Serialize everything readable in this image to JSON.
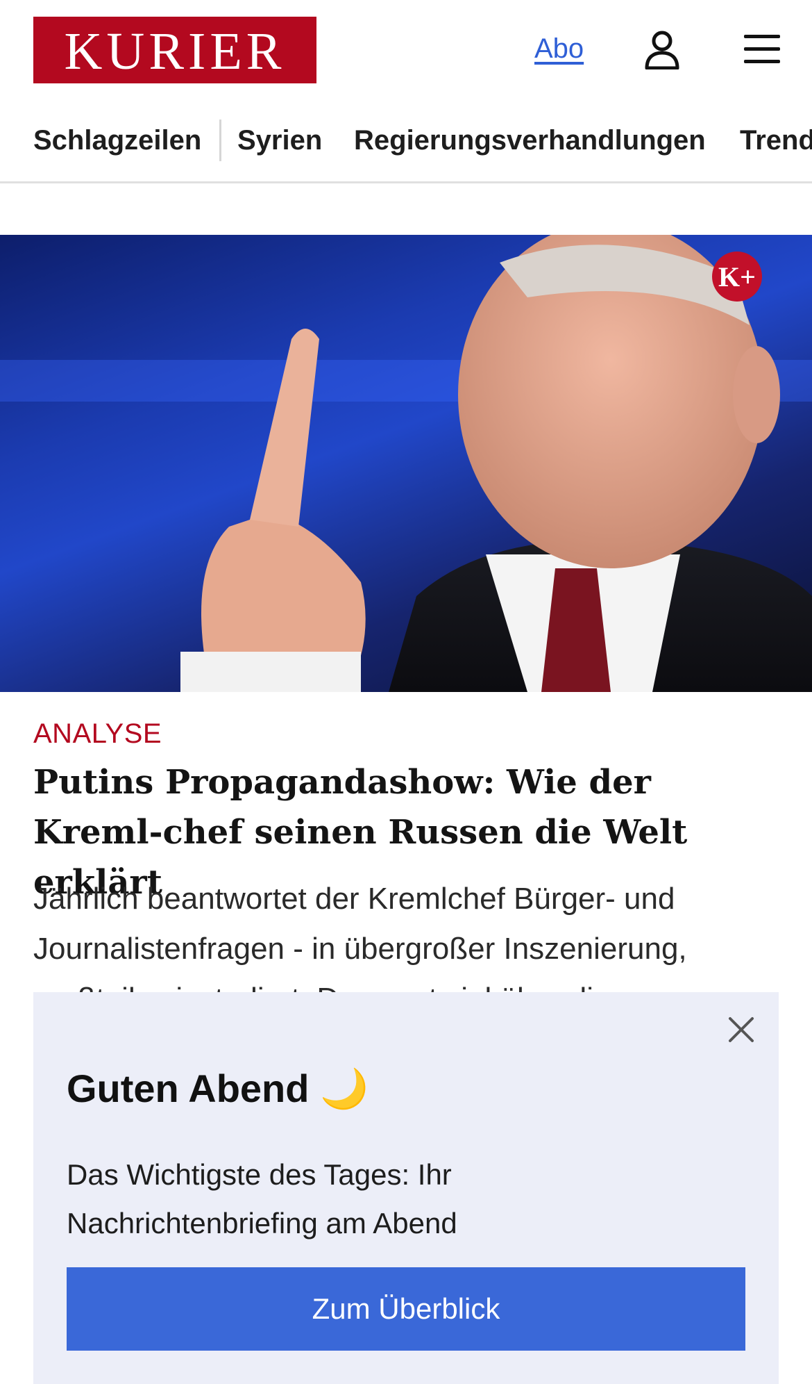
{
  "header": {
    "logo_text": "KURIER",
    "abo_label": "Abo",
    "user_icon": "user-icon",
    "menu_icon": "hamburger-menu-icon"
  },
  "nav": {
    "items": [
      {
        "label": "Schlagzeilen"
      },
      {
        "label": "Syrien"
      },
      {
        "label": "Regierungsverhandlungen"
      },
      {
        "label": "Trend"
      }
    ]
  },
  "hero": {
    "badge_text": "K+",
    "brand_color": "#b3091f"
  },
  "article": {
    "kicker": "ANALYSE",
    "headline": "Putins Propagandashow: Wie der Kreml-chef seinen Russen die Welt erklärt",
    "teaser": "Jährlich beantwortet der Kremlchef Bürger- und Journalistenfragen - in übergroßer Inszenierung, großteils einstudiert. Das sagt viel über die"
  },
  "popup": {
    "title": "Guten Abend 🌙",
    "text": "Das Wichtigste des Tages: Ihr Nachrichtenbriefing am Abend",
    "button_label": "Zum Überblick",
    "close_icon": "close-icon",
    "button_color": "#3a68d8"
  }
}
